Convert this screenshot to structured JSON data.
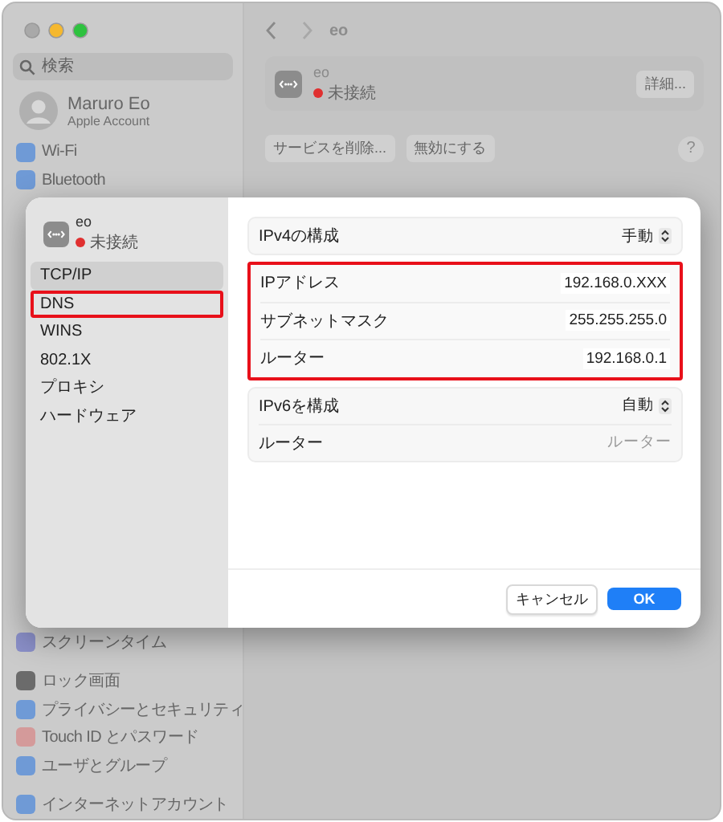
{
  "window": {
    "title": "eo"
  },
  "sidebar": {
    "search": {
      "placeholder": "検索"
    },
    "account": {
      "name": "Maruro Eo",
      "subtitle": "Apple Account"
    },
    "items_top": [
      {
        "label": "Wi-Fi",
        "color": "#6f9ad6"
      },
      {
        "label": "Bluetooth",
        "color": "#6f9ad6"
      }
    ],
    "groups_bottom": [
      {
        "items": [
          {
            "label": "スクリーンタイム",
            "color": "#8a8fc8"
          }
        ]
      },
      {
        "items": [
          {
            "label": "ロック画面",
            "color": "#6b6b6b"
          },
          {
            "label": "プライバシーとセキュリティ",
            "color": "#6f9ad6"
          },
          {
            "label": "Touch ID とパスワード",
            "color": "#d49a9a"
          },
          {
            "label": "ユーザとグループ",
            "color": "#6f9ad6"
          }
        ]
      },
      {
        "items": [
          {
            "label": "インターネットアカウント",
            "color": "#6f9ad6"
          }
        ]
      }
    ]
  },
  "service": {
    "name": "eo",
    "status": "未接続",
    "details_button": "詳細...",
    "buttons": [
      "サービスを削除...",
      "無効にする"
    ],
    "help": "?"
  },
  "sheet": {
    "service": {
      "name": "eo",
      "status": "未接続"
    },
    "tabs": [
      {
        "label": "TCP/IP",
        "selected": true,
        "highlighted": false
      },
      {
        "label": "DNS",
        "selected": false,
        "highlighted": true
      },
      {
        "label": "WINS",
        "selected": false,
        "highlighted": false
      },
      {
        "label": "802.1X",
        "selected": false,
        "highlighted": false
      },
      {
        "label": "プロキシ",
        "selected": false,
        "highlighted": false
      },
      {
        "label": "ハードウェア",
        "selected": false,
        "highlighted": false
      }
    ],
    "groups": [
      {
        "highlighted": false,
        "rows": [
          {
            "kind": "popup",
            "label": "IPv4の構成",
            "value": "手動"
          }
        ]
      },
      {
        "highlighted": true,
        "rows": [
          {
            "kind": "text",
            "label": "IPアドレス",
            "value": "192.168.0.XXX"
          },
          {
            "kind": "text",
            "label": "サブネットマスク",
            "value": "255.255.255.0"
          },
          {
            "kind": "text",
            "label": "ルーター",
            "value": "192.168.0.1"
          }
        ]
      },
      {
        "highlighted": false,
        "rows": [
          {
            "kind": "popup",
            "label": "IPv6を構成",
            "value": "自動"
          },
          {
            "kind": "field",
            "label": "ルーター",
            "placeholder": "ルーター"
          }
        ]
      }
    ],
    "buttons": [
      {
        "label": "キャンセル",
        "kind": "secondary"
      },
      {
        "label": "OK",
        "kind": "primary"
      }
    ]
  }
}
